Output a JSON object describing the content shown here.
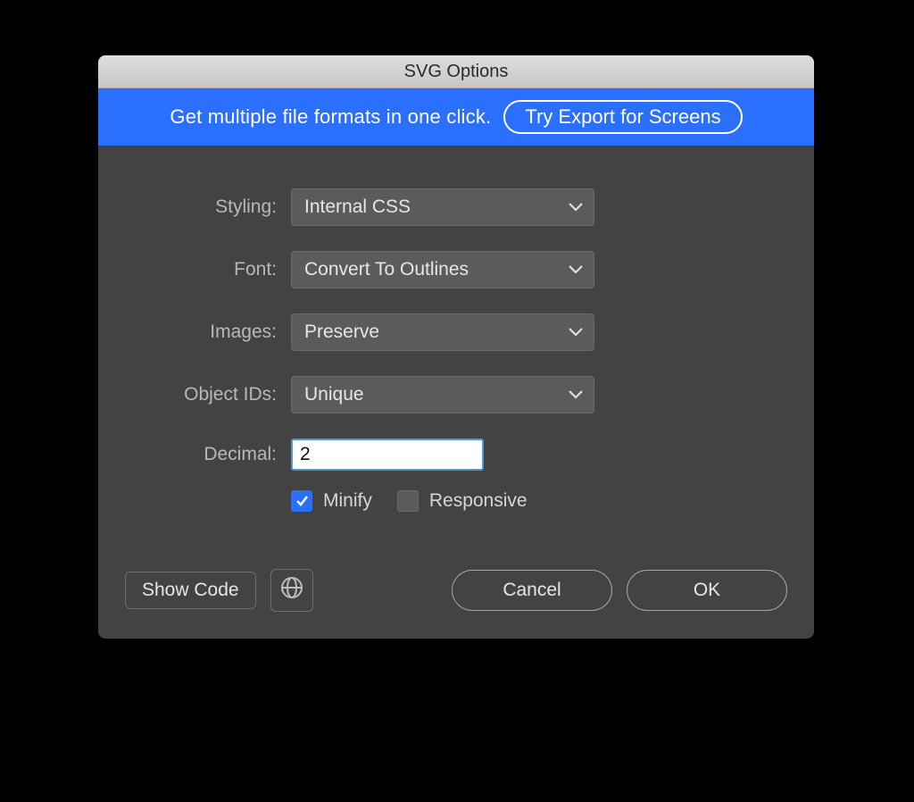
{
  "dialog": {
    "title": "SVG Options"
  },
  "banner": {
    "text": "Get multiple file formats in one click.",
    "button": "Try Export for Screens"
  },
  "form": {
    "styling": {
      "label": "Styling:",
      "value": "Internal CSS"
    },
    "font": {
      "label": "Font:",
      "value": "Convert To Outlines"
    },
    "images": {
      "label": "Images:",
      "value": "Preserve"
    },
    "objectIds": {
      "label": "Object IDs:",
      "value": "Unique"
    },
    "decimal": {
      "label": "Decimal:",
      "value": "2"
    },
    "minify": {
      "label": "Minify",
      "checked": true
    },
    "responsive": {
      "label": "Responsive",
      "checked": false
    }
  },
  "footer": {
    "showCode": "Show Code",
    "cancel": "Cancel",
    "ok": "OK"
  }
}
